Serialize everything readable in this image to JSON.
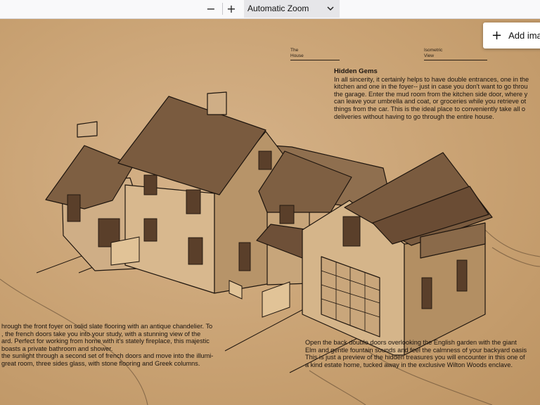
{
  "toolbar": {
    "zoom_out_icon": "minus-icon",
    "zoom_in_icon": "plus-icon",
    "zoom_value": "Automatic Zoom",
    "dropdown_icon": "chevron-down-icon"
  },
  "overlay": {
    "add_button_label": "Add ima",
    "add_button_icon": "plus-icon"
  },
  "document": {
    "caption_left": [
      "The",
      "House"
    ],
    "caption_right": [
      "Isometric",
      "View"
    ],
    "hidden_gems": {
      "heading": "Hidden Gems",
      "lines": [
        "In all sincerity, it certainly helps to have double entrances, one in the",
        "kitchen and one in the foyer-- just in case you don't want to go throu",
        "the garage. Enter the mud room from the kitchen side door, where y",
        "can leave your umbrella and coat, or groceries while you retrieve ot",
        "things from the car. This is the ideal place to conveniently take all o",
        "deliveries without having to go through the entire house."
      ]
    },
    "left_block": {
      "lines": [
        "hrough the front foyer on solid slate flooring with an antique chandelier. To",
        ", the french doors take you into your study, with a stunning view of the",
        "ard. Perfect for working from home with it's stately fireplace, this majestic",
        "boasts a private bathroom and shower.",
        " the sunlight through a second set of french doors and move into the illumi-",
        "great room, three sides glass, with stone flooring and Greek columns."
      ]
    },
    "right_block": {
      "lines": [
        "Open the back double doors overlooking the English garden with the giant",
        "Elm and gentle fountain sounds and feel the calmness of your backyard oasis",
        "This is just a preview of the hidden treasures you will encounter in this one of",
        "a kind estate home, tucked away in the exclusive Wilton Woods enclave."
      ]
    }
  },
  "colors": {
    "paper": "#c9a273",
    "ink": "#1c1510",
    "toolbar": "#f9f9fa",
    "zoom_select": "#e6e6e9"
  }
}
